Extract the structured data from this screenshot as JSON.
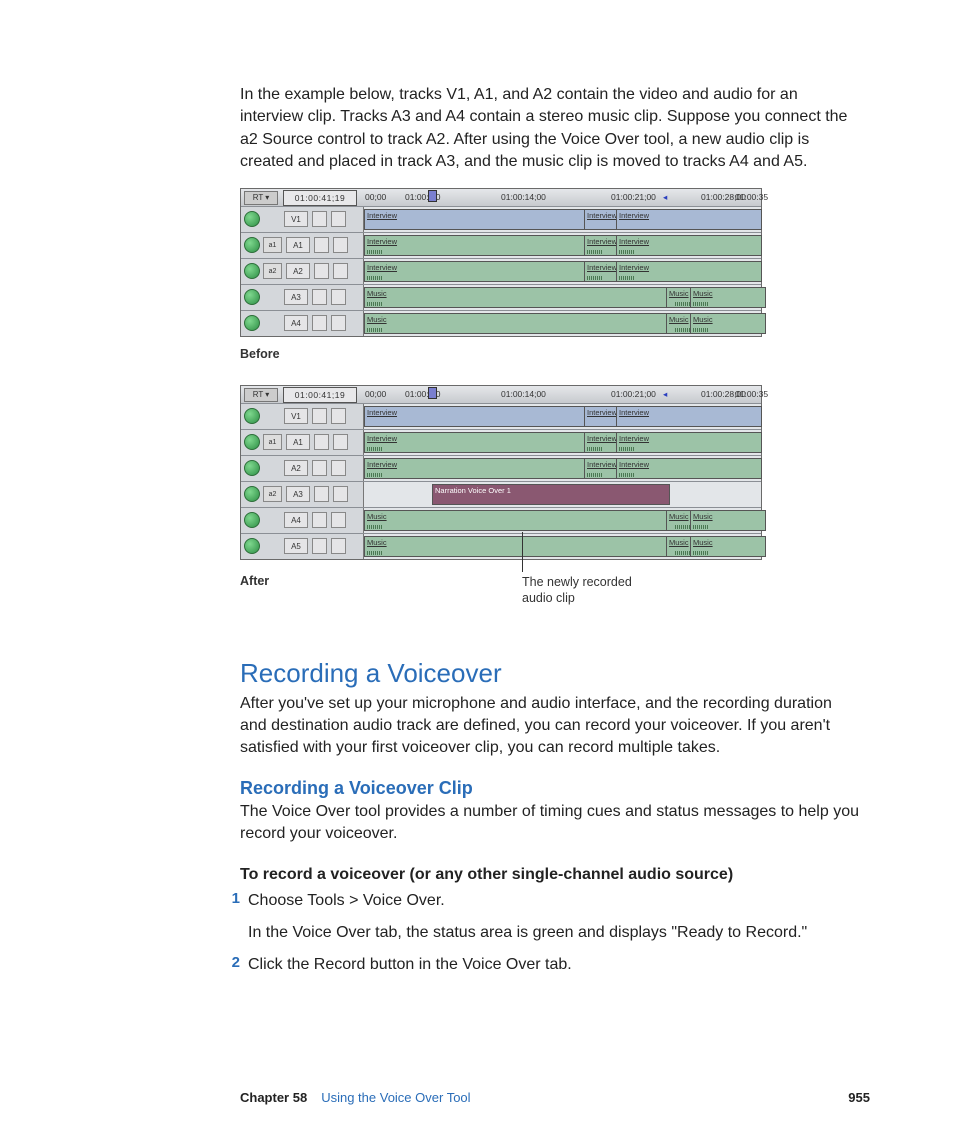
{
  "intro": "In the example below, tracks V1, A1, and A2 contain the video and audio for an interview clip. Tracks A3 and A4 contain a stereo music clip. Suppose you connect the a2 Source control to track A2. After using the Voice Over tool, a new audio clip is created and placed in track A3, and the music clip is moved to tracks A4 and A5.",
  "label_before": "Before",
  "label_after": "After",
  "callout": "The newly recorded audio clip",
  "section_title": "Recording a Voiceover",
  "section_body": "After you've set up your microphone and audio interface, and the recording duration and destination audio track are defined, you can record your voiceover. If you aren't satisfied with your first voiceover clip, you can record multiple takes.",
  "subsection_title": "Recording a Voiceover Clip",
  "subsection_body": "The Voice Over tool provides a number of timing cues and status messages to help you record your voiceover.",
  "procedure_title": "To record a voiceover (or any other single-channel audio source)",
  "steps": {
    "s1": "Choose Tools > Voice Over.",
    "s1b": "In the Voice Over tab, the status area is green and displays \"Ready to Record.\"",
    "s2": "Click the Record button in the Voice Over tab."
  },
  "footer": {
    "chapter": "Chapter 58",
    "title": "Using the Voice Over Tool",
    "page": "955"
  },
  "timeline": {
    "rt": "RT ▾",
    "tc": "01:00:41;19",
    "ruler": [
      "00;00",
      "01:00:",
      "00",
      "01:00:14;00",
      "01:00:21;00",
      "01:00:28;00",
      "01:00:35"
    ],
    "tracks_before": {
      "v1": "V1",
      "a1": "A1",
      "a2": "A2",
      "a3": "A3",
      "a4": "A4",
      "src_a1": "a1",
      "src_a2": "a2"
    },
    "tracks_after": {
      "v1": "V1",
      "a1": "A1",
      "a2": "A2",
      "a3": "A3",
      "a4": "A4",
      "a5": "A5",
      "src_a1": "a1",
      "src_a2": "a2"
    },
    "clips": {
      "interview": "Interview",
      "music": "Music",
      "voiceover": "Narration Voice Over  1"
    }
  }
}
